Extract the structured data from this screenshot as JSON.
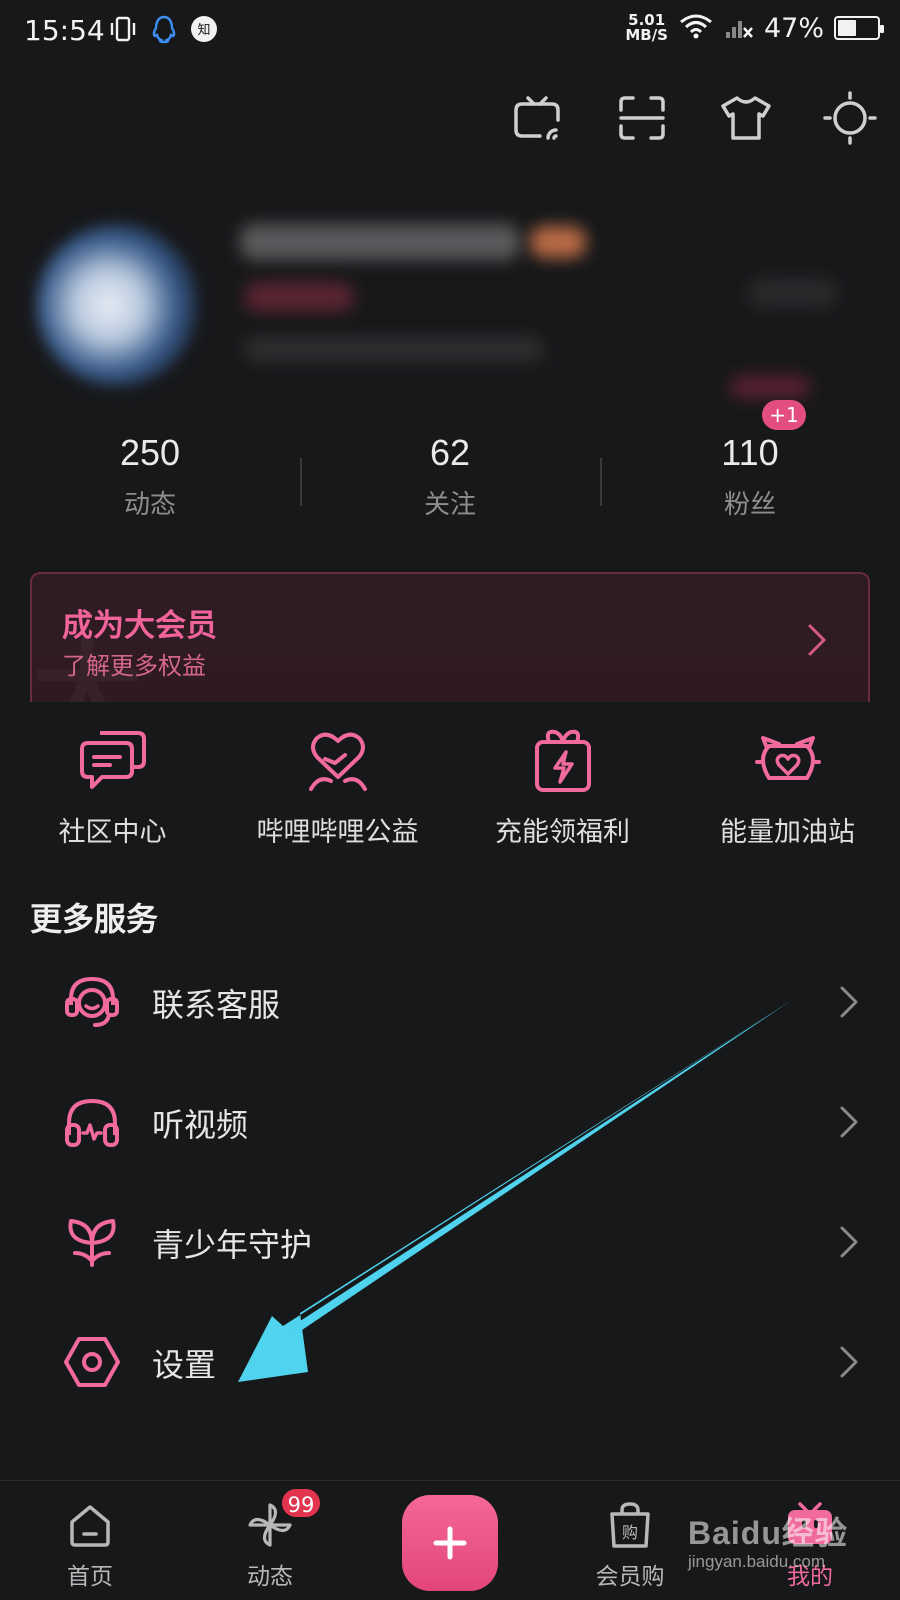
{
  "status_bar": {
    "time": "15:54",
    "net_speed_value": "5.01",
    "net_speed_unit": "MB/S",
    "battery_percent": "47%",
    "battery_level": 0.47
  },
  "top_actions": [
    {
      "icon": "tv-cast-icon"
    },
    {
      "icon": "scan-icon"
    },
    {
      "icon": "tshirt-icon"
    },
    {
      "icon": "theme-sun-icon"
    }
  ],
  "stats": [
    {
      "value": "250",
      "label": "动态"
    },
    {
      "value": "62",
      "label": "关注"
    },
    {
      "value": "110",
      "label": "粉丝"
    }
  ],
  "fans_badge": "+1",
  "vip": {
    "title": "成为大会员",
    "subtitle": "了解更多权益"
  },
  "quick_links": [
    {
      "label": "社区中心",
      "icon": "community-chat-icon"
    },
    {
      "label": "哔哩哔哩公益",
      "icon": "heart-charity-icon"
    },
    {
      "label": "充能领福利",
      "icon": "gift-energy-icon"
    },
    {
      "label": "能量加油站",
      "icon": "energy-station-icon"
    }
  ],
  "more_services": {
    "title": "更多服务",
    "items": [
      {
        "label": "联系客服",
        "icon": "customer-service-icon"
      },
      {
        "label": "听视频",
        "icon": "headphones-icon"
      },
      {
        "label": "青少年守护",
        "icon": "sprout-icon"
      },
      {
        "label": "设置",
        "icon": "settings-hex-icon"
      }
    ]
  },
  "tabbar": {
    "tabs": [
      {
        "label": "首页",
        "icon": "home-icon"
      },
      {
        "label": "动态",
        "icon": "pinwheel-icon",
        "badge": "99"
      },
      {
        "label": "",
        "icon": "plus-icon"
      },
      {
        "label": "会员购",
        "icon": "shopping-bag-icon"
      },
      {
        "label": "我的",
        "icon": "tv-mine-icon"
      }
    ]
  },
  "colors": {
    "background": "#17181a",
    "accent_pink": "#f1649b",
    "annotation_arrow": "#4fd3ee"
  },
  "watermark": {
    "logo": "Baidu经验",
    "url": "jingyan.baidu.com"
  }
}
